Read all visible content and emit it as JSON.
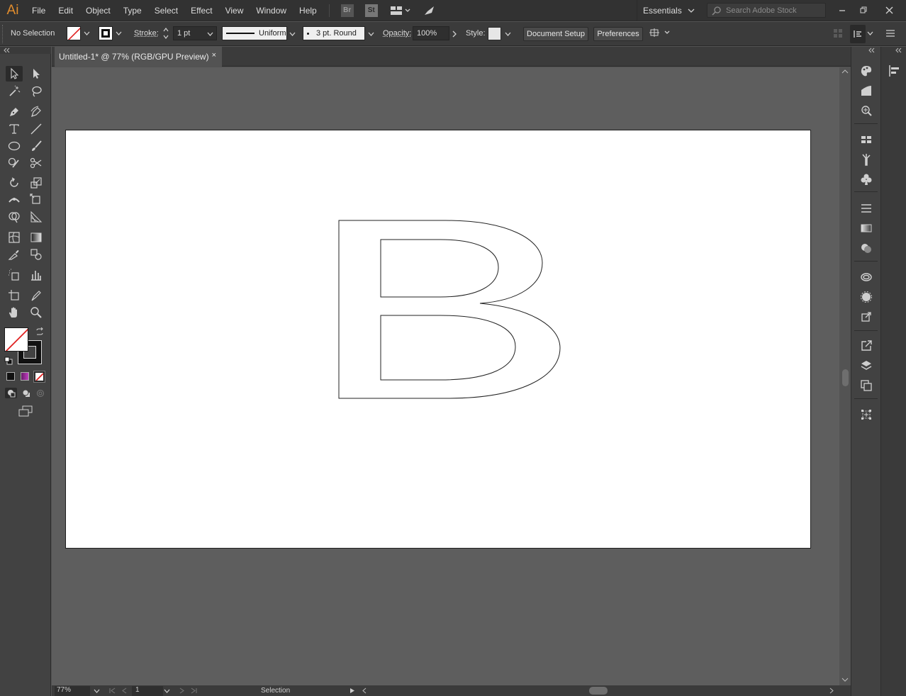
{
  "app": {
    "logo_text": "Ai"
  },
  "menu": {
    "items": [
      "File",
      "Edit",
      "Object",
      "Type",
      "Select",
      "Effect",
      "View",
      "Window",
      "Help"
    ],
    "bridge_label": "Br",
    "stock_label": "St",
    "workspace": "Essentials",
    "search_placeholder": "Search Adobe Stock"
  },
  "control_bar": {
    "selection_text": "No Selection",
    "stroke_label": "Stroke:",
    "stroke_weight": "1 pt",
    "stroke_profile": "Uniform",
    "brush": "3 pt. Round",
    "opacity_label": "Opacity:",
    "opacity_value": "100%",
    "style_label": "Style:",
    "document_setup_label": "Document Setup",
    "preferences_label": "Preferences"
  },
  "document": {
    "tab_title": "Untitled-1* @ 77% (RGB/GPU Preview)",
    "close_glyph": "×"
  },
  "status_bar": {
    "zoom": "77%",
    "artboard_number": "1",
    "tool_status": "Selection"
  },
  "colors": {
    "accent_logo": "#e28d2d",
    "canvas_bg": "#5e5e5e",
    "artboard_bg": "#ffffff",
    "panel_bg": "#424242",
    "menubar_bg": "#323232"
  }
}
